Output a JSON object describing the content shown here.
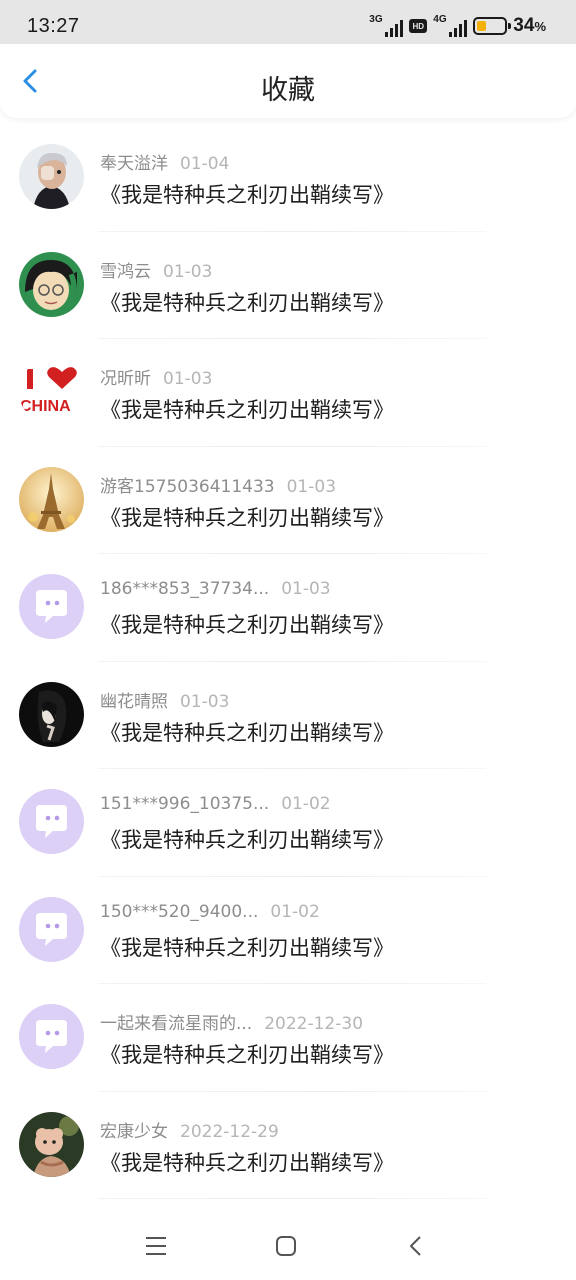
{
  "status_bar": {
    "time": "13:27",
    "network1": "3G",
    "hd": "HD",
    "network2": "4G",
    "battery_percent": "34",
    "battery_unit": "%",
    "battery_level": 0.34
  },
  "header": {
    "title": "收藏",
    "back_icon": "chevron-left-icon"
  },
  "favorites": [
    {
      "user": "奉天溢洋",
      "date": "01-04",
      "book": "《我是特种兵之利刃出鞘续写》",
      "avatar": "photo-man"
    },
    {
      "user": "雪鸿云",
      "date": "01-03",
      "book": "《我是特种兵之利刃出鞘续写》",
      "avatar": "cartoon-glasses"
    },
    {
      "user": "况昕昕",
      "date": "01-03",
      "book": "《我是特种兵之利刃出鞘续写》",
      "avatar": "i-love-china"
    },
    {
      "user": "游客1575036411433",
      "date": "01-03",
      "book": "《我是特种兵之利刃出鞘续写》",
      "avatar": "eiffel-tower"
    },
    {
      "user": "186***853_37734...",
      "date": "01-03",
      "book": "《我是特种兵之利刃出鞘续写》",
      "avatar": "default-chat"
    },
    {
      "user": "幽花晴照",
      "date": "01-03",
      "book": "《我是特种兵之利刃出鞘续写》",
      "avatar": "dark-portrait"
    },
    {
      "user": "151***996_10375...",
      "date": "01-02",
      "book": "《我是特种兵之利刃出鞘续写》",
      "avatar": "default-chat"
    },
    {
      "user": "150***520_9400...",
      "date": "01-02",
      "book": "《我是特种兵之利刃出鞘续写》",
      "avatar": "default-chat"
    },
    {
      "user": "一起来看流星雨的...",
      "date": "2022-12-30",
      "book": "《我是特种兵之利刃出鞘续写》",
      "avatar": "default-chat"
    },
    {
      "user": "宏康少女",
      "date": "2022-12-29",
      "book": "《我是特种兵之利刃出鞘续写》",
      "avatar": "photo-girl"
    }
  ],
  "nav_bar": {
    "menu_icon": "menu-icon",
    "home_icon": "home-icon",
    "back_icon": "back-icon"
  },
  "colors": {
    "accent": "#2b8fe6",
    "default_avatar_bg": "#ddd0f7",
    "battery_fill": "#f4b10b"
  }
}
